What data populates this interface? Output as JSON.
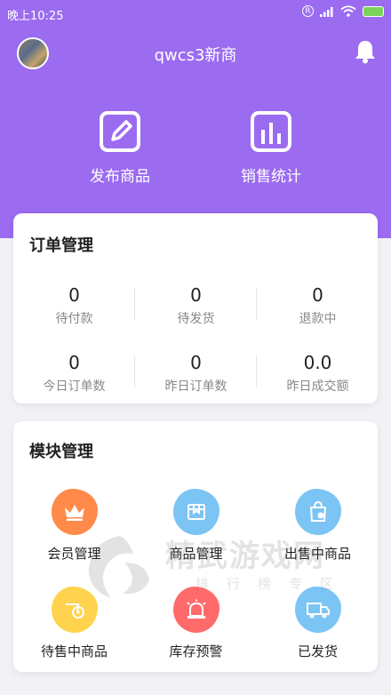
{
  "status_bar": {
    "time": "晚上10:25",
    "r_badge": "R"
  },
  "header": {
    "shop_name": "qwcs3新商",
    "bg_color": "#9b6bf0"
  },
  "quick_actions": [
    {
      "label": "发布商品",
      "icon": "edit-icon"
    },
    {
      "label": "销售统计",
      "icon": "bar-chart-icon"
    }
  ],
  "orders": {
    "title": "订单管理",
    "stats": [
      {
        "value": "0",
        "label": "待付款"
      },
      {
        "value": "0",
        "label": "待发货"
      },
      {
        "value": "0",
        "label": "退款中"
      },
      {
        "value": "0",
        "label": "今日订单数"
      },
      {
        "value": "0",
        "label": "昨日订单数"
      },
      {
        "value": "0.0",
        "label": "昨日成交额"
      }
    ]
  },
  "modules": {
    "title": "模块管理",
    "items": [
      {
        "label": "会员管理",
        "icon": "crown-icon",
        "color": "#ff8a4a"
      },
      {
        "label": "商品管理",
        "icon": "box-icon",
        "color": "#7cc4f4"
      },
      {
        "label": "出售中商品",
        "icon": "shopping-bag-icon",
        "color": "#7cc4f4"
      },
      {
        "label": "待售中商品",
        "icon": "clock-icon",
        "color": "#ffd34d"
      },
      {
        "label": "库存预警",
        "icon": "alarm-icon",
        "color": "#ff6b6b"
      },
      {
        "label": "已发货",
        "icon": "truck-icon",
        "color": "#7cc4f4"
      }
    ]
  },
  "watermark": {
    "title": "精武游戏网",
    "subtitle": "排行榜专区"
  }
}
